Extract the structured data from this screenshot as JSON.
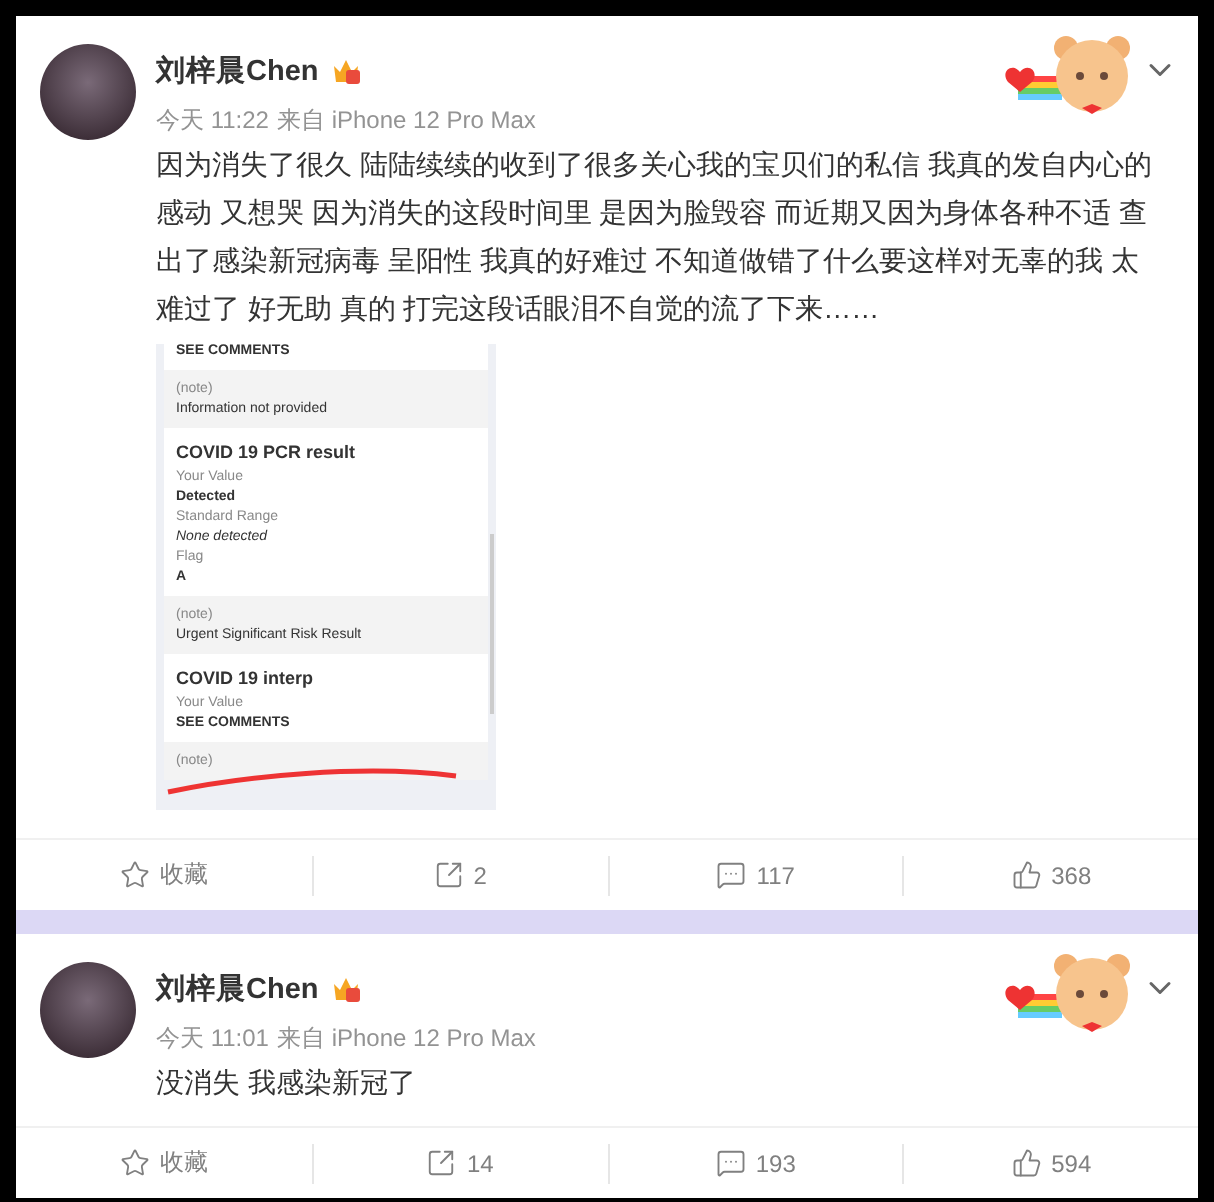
{
  "posts": [
    {
      "author": "刘梓晨Chen",
      "time": "今天 11:22",
      "source": "来自 iPhone 12 Pro Max",
      "text": "因为消失了很久 陆陆续续的收到了很多关心我的宝贝们的私信 我真的发自内心的感动 又想哭 因为消失的这段时间里 是因为脸毁容 而近期又因为身体各种不适 查出了感染新冠病毒 呈阳性 我真的好难过 不知道做错了什么要这样对无辜的我 太难过了 好无助 真的 打完这段话眼泪不自觉的流了下来……",
      "image": {
        "blocks": [
          {
            "shaded": false,
            "lines": [
              {
                "kind": "value",
                "text": "SEE COMMENTS"
              }
            ]
          },
          {
            "shaded": true,
            "lines": [
              {
                "kind": "label",
                "text": "(note)"
              },
              {
                "kind": "plain",
                "text": "Information not provided"
              }
            ]
          },
          {
            "shaded": false,
            "lines": [
              {
                "kind": "heading",
                "text": "COVID 19 PCR result"
              },
              {
                "kind": "label",
                "text": "Your Value"
              },
              {
                "kind": "value",
                "text": "Detected"
              },
              {
                "kind": "label",
                "text": "Standard Range"
              },
              {
                "kind": "italic",
                "text": "None detected"
              },
              {
                "kind": "label",
                "text": "Flag"
              },
              {
                "kind": "value",
                "text": "A"
              }
            ]
          },
          {
            "shaded": true,
            "lines": [
              {
                "kind": "label",
                "text": "(note)"
              },
              {
                "kind": "plain",
                "text": "Urgent Significant Risk Result"
              }
            ]
          },
          {
            "shaded": false,
            "lines": [
              {
                "kind": "heading",
                "text": "COVID 19 interp"
              },
              {
                "kind": "label",
                "text": "Your Value"
              },
              {
                "kind": "value",
                "text": "SEE COMMENTS"
              }
            ]
          },
          {
            "shaded": true,
            "lines": [
              {
                "kind": "label",
                "text": "(note)"
              }
            ]
          }
        ]
      },
      "actions": [
        {
          "kind": "favorite",
          "label": "收藏"
        },
        {
          "kind": "repost",
          "label": "2"
        },
        {
          "kind": "comment",
          "label": "117"
        },
        {
          "kind": "like",
          "label": "368"
        }
      ]
    },
    {
      "author": "刘梓晨Chen",
      "time": "今天 11:01",
      "source": "来自 iPhone 12 Pro Max",
      "text": "没消失 我感染新冠了",
      "actions": [
        {
          "kind": "favorite",
          "label": "收藏"
        },
        {
          "kind": "repost",
          "label": "14"
        },
        {
          "kind": "comment",
          "label": "193"
        },
        {
          "kind": "like",
          "label": "594"
        }
      ]
    }
  ]
}
